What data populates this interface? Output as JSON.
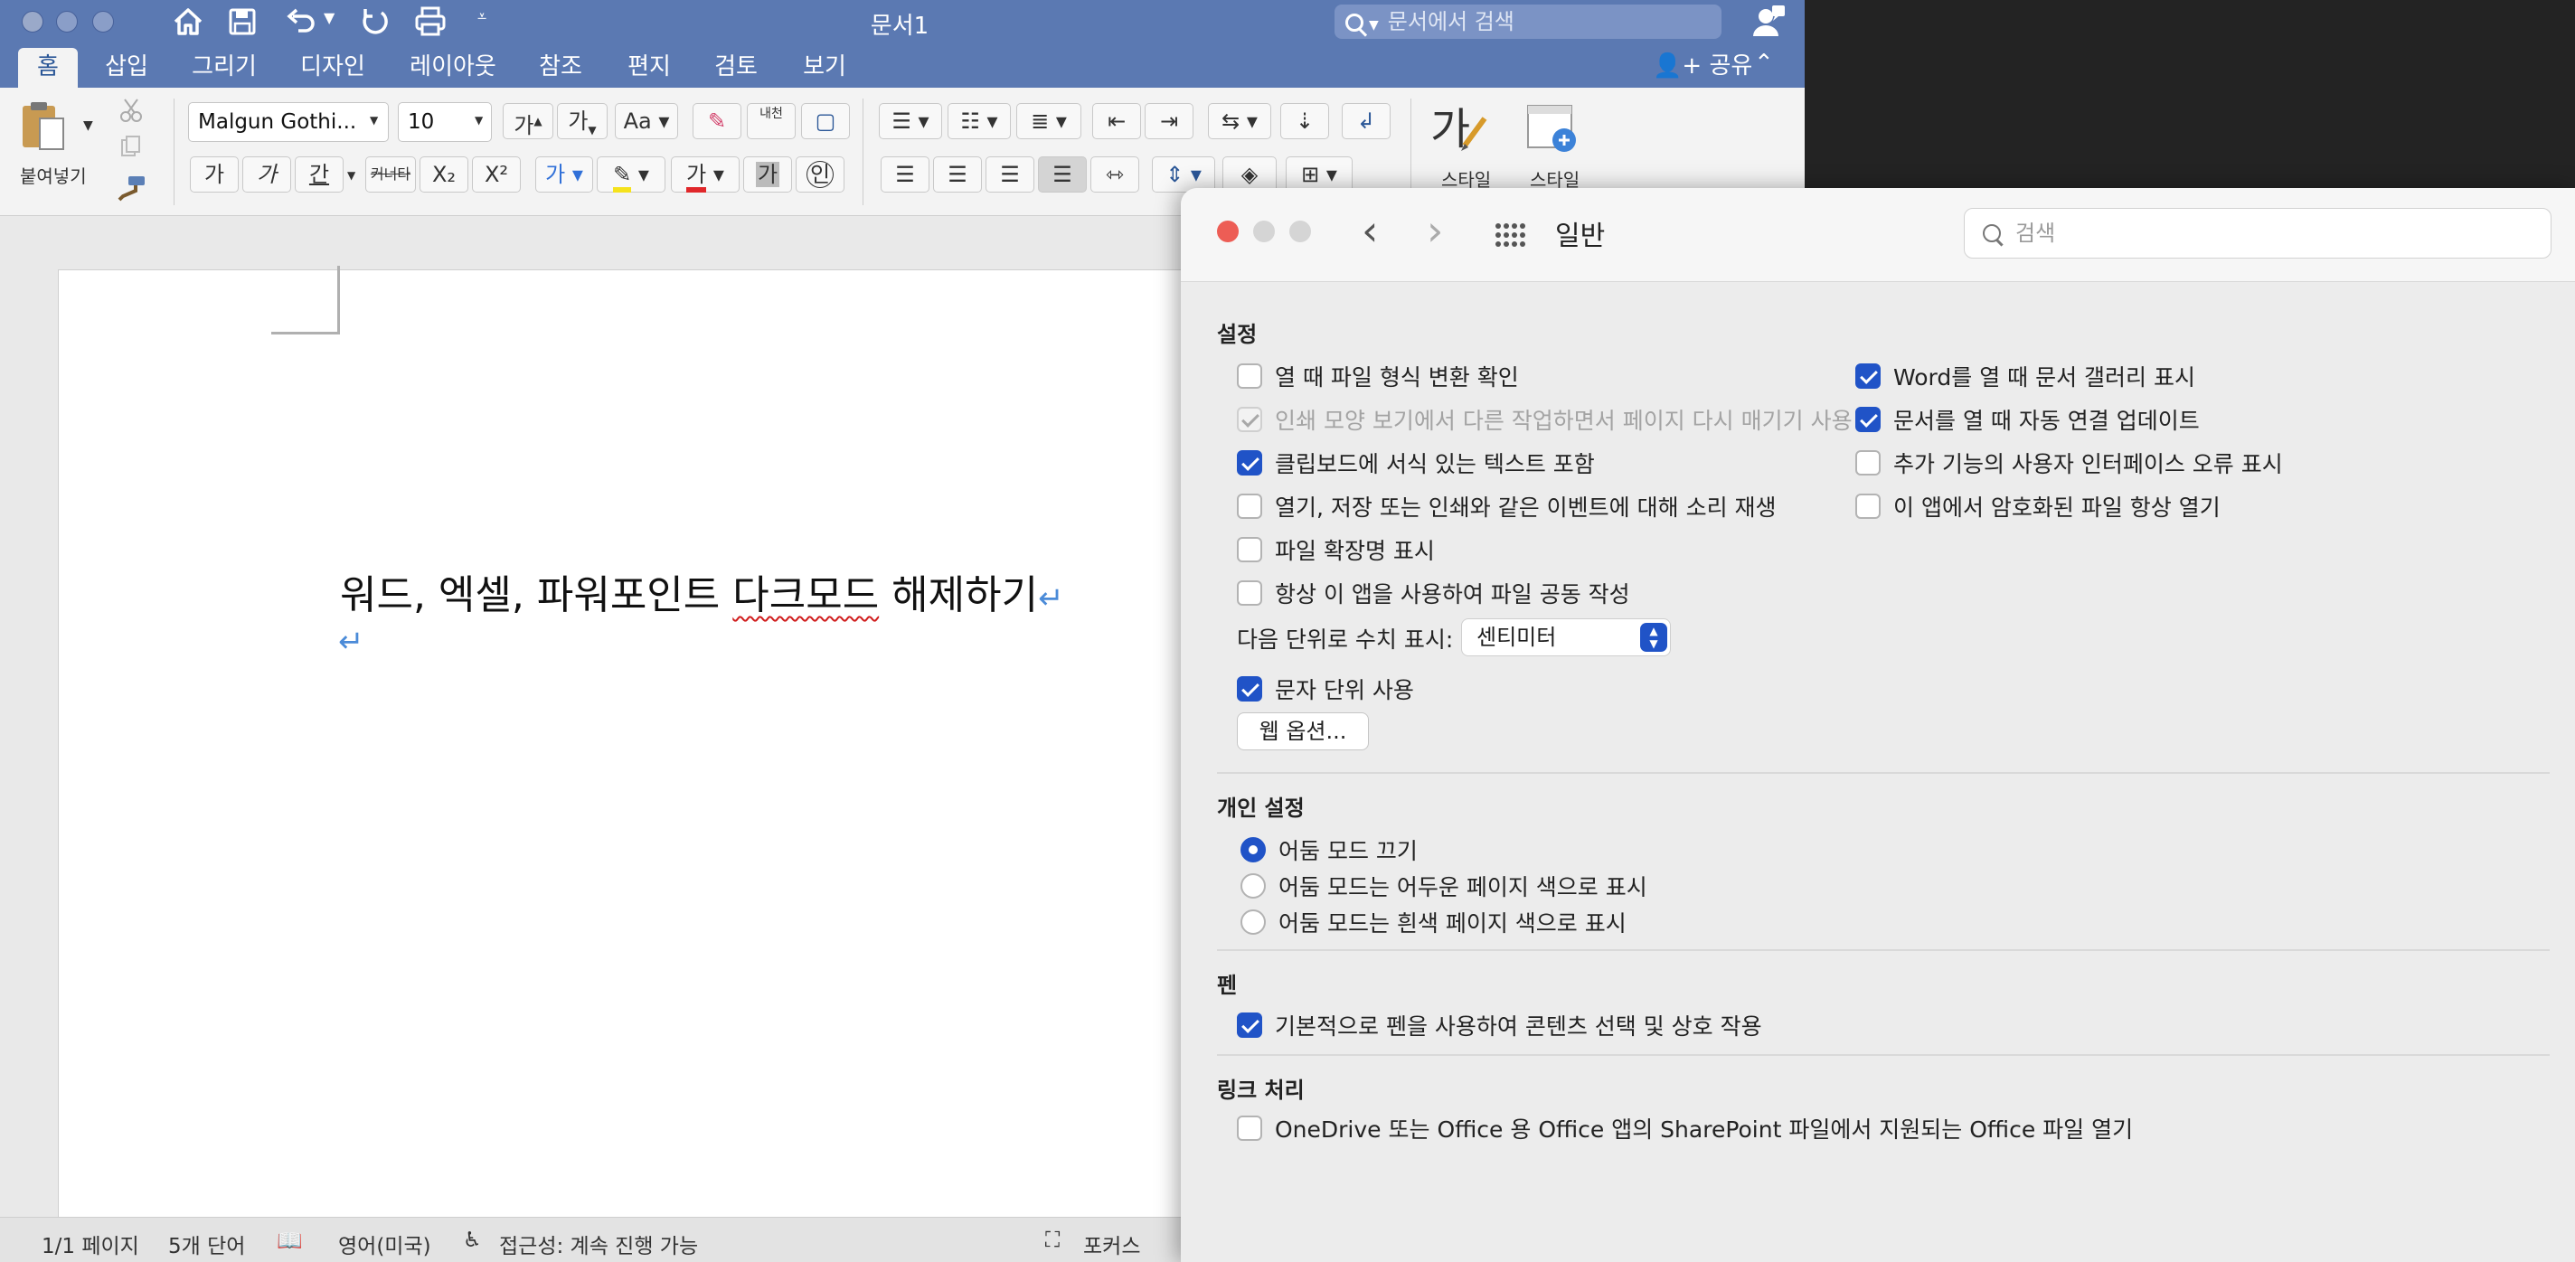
{
  "word": {
    "title": "문서1",
    "search_placeholder": "문서에서 검색",
    "tabs": [
      "홈",
      "삽입",
      "그리기",
      "디자인",
      "레이아웃",
      "참조",
      "편지",
      "검토",
      "보기"
    ],
    "share_label": "공유",
    "ribbon": {
      "paste_label": "붙여넣기",
      "font_name": "Malgun Gothi...",
      "font_size": "10",
      "grow_font": "가",
      "shrink_font": "가",
      "phonetic": "내천",
      "bold": "가",
      "italic": "가",
      "underline": "간",
      "strike": "커너타",
      "subscript": "X₂",
      "superscript": "X²",
      "font_color_glyph": "가",
      "char_shade": "가",
      "enclose": "인",
      "styles_label": "스타일",
      "styles_pane_label": "스타일"
    },
    "document": {
      "text_before": "워드, 엑셀, 파워포인트 ",
      "text_misspelled": "다크모드",
      "text_after": " 해제하기",
      "pilcrow": "↵"
    },
    "status": {
      "page": "1/1 페이지",
      "words": "5개 단어",
      "language": "영어(미국)",
      "accessibility": "접근성: 계속 진행 가능",
      "focus": "포커스"
    }
  },
  "prefs": {
    "title": "일반",
    "search_placeholder": "검색",
    "sections": {
      "settings": "설정",
      "personal": "개인 설정",
      "pen": "펜",
      "links": "링크 처리"
    },
    "settings_left": [
      {
        "label": "열 때 파일 형식 변환 확인",
        "checked": false,
        "disabled": false
      },
      {
        "label": "인쇄 모양 보기에서 다른 작업하면서 페이지 다시 매기기 사용",
        "checked": true,
        "disabled": true
      },
      {
        "label": "클립보드에 서식 있는 텍스트 포함",
        "checked": true,
        "disabled": false
      },
      {
        "label": "열기, 저장 또는 인쇄와 같은 이벤트에 대해 소리 재생",
        "checked": false,
        "disabled": false
      },
      {
        "label": "파일 확장명 표시",
        "checked": false,
        "disabled": false
      },
      {
        "label": "항상 이 앱을 사용하여 파일 공동 작성",
        "checked": false,
        "disabled": false
      }
    ],
    "settings_right": [
      {
        "label": "Word를 열 때 문서 갤러리 표시",
        "checked": true
      },
      {
        "label": "문서를 열 때 자동 연결 업데이트",
        "checked": true
      },
      {
        "label": "추가 기능의 사용자 인터페이스 오류 표시",
        "checked": false
      },
      {
        "label": "이 앱에서 암호화된 파일 항상 열기",
        "checked": false
      }
    ],
    "units_label": "다음 단위로 수치 표시:",
    "units_value": "센티미터",
    "char_units": {
      "label": "문자 단위 사용",
      "checked": true
    },
    "web_options_button": "웹 옵션...",
    "dark_mode": [
      {
        "label": "어둠 모드 끄기",
        "selected": true
      },
      {
        "label": "어둠 모드는 어두운 페이지 색으로 표시",
        "selected": false
      },
      {
        "label": "어둠 모드는 흰색 페이지 색으로 표시",
        "selected": false
      }
    ],
    "pen_option": {
      "label": "기본적으로 펜을 사용하여 콘텐츠 선택 및 상호 작용",
      "checked": true
    },
    "link_option": {
      "label": "OneDrive 또는 Office 용 Office 앱의 SharePoint 파일에서 지원되는 Office 파일 열기",
      "checked": false
    }
  }
}
